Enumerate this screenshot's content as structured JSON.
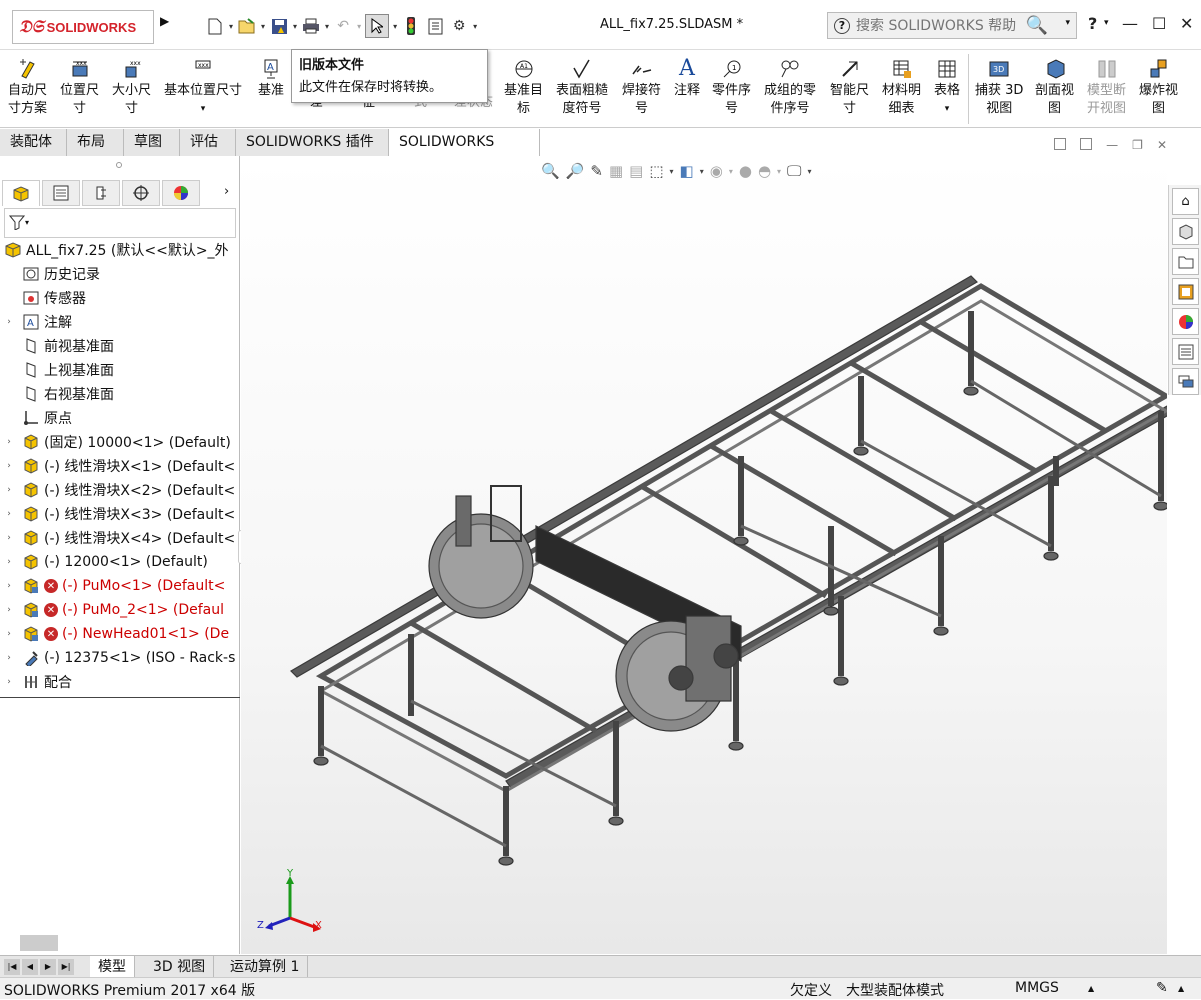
{
  "app": {
    "logo_brand": "SOLIDWORKS",
    "document_title": "ALL_fix7.25.SLDASM *"
  },
  "search": {
    "placeholder": "搜索 SOLIDWORKS 帮助"
  },
  "window_controls": {
    "help": "?",
    "minimize": "—",
    "maximize": "☐",
    "close": "✕"
  },
  "tooltip": {
    "title": "旧版本文件",
    "text": "此文件在保存时将转换。"
  },
  "ribbon": {
    "items": [
      {
        "id": "auto-dim",
        "line1": "自动尺",
        "line2": "寸方案",
        "icon": "auto-dimension-icon",
        "enabled": true
      },
      {
        "id": "loc-dim",
        "line1": "位置尺",
        "line2": "寸",
        "icon": "location-dimension-icon",
        "enabled": true
      },
      {
        "id": "size-dim",
        "line1": "大小尺",
        "line2": "寸",
        "icon": "size-dimension-icon",
        "enabled": true
      },
      {
        "id": "basic-loc-dim",
        "line1": "基本位置尺寸",
        "line2": "▾",
        "icon": "basic-location-icon",
        "enabled": true
      },
      {
        "id": "datum",
        "line1": "基准",
        "line2": "",
        "icon": "datum-icon",
        "enabled": true
      },
      {
        "id": "tolerance",
        "line1": "",
        "line2": "差",
        "icon": "",
        "enabled": true
      },
      {
        "id": "feature",
        "line1": "",
        "line2": "征",
        "icon": "",
        "enabled": true
      },
      {
        "id": "style",
        "line1": "",
        "line2": "式",
        "icon": "",
        "enabled": false
      },
      {
        "id": "tol-state",
        "line1": "公",
        "line2": "差状态",
        "icon": "",
        "enabled": false
      },
      {
        "id": "datum-target",
        "line1": "基准目",
        "line2": "标",
        "icon": "datum-target-icon",
        "enabled": true
      },
      {
        "id": "surface-finish",
        "line1": "表面粗糙",
        "line2": "度符号",
        "icon": "surface-finish-icon",
        "enabled": true
      },
      {
        "id": "weld",
        "line1": "焊接符",
        "line2": "号",
        "icon": "weld-symbol-icon",
        "enabled": true
      },
      {
        "id": "note",
        "line1": "注释",
        "line2": "",
        "icon": "note-icon",
        "enabled": true
      },
      {
        "id": "balloon",
        "line1": "零件序",
        "line2": "号",
        "icon": "balloon-icon",
        "enabled": true
      },
      {
        "id": "stacked-balloon",
        "line1": "成组的零",
        "line2": "件序号",
        "icon": "stacked-balloon-icon",
        "enabled": true
      },
      {
        "id": "smart-dim",
        "line1": "智能尺",
        "line2": "寸",
        "icon": "smart-dimension-icon",
        "enabled": true
      },
      {
        "id": "bom",
        "line1": "材料明",
        "line2": "细表",
        "icon": "bom-icon",
        "enabled": true
      },
      {
        "id": "table",
        "line1": "表格",
        "line2": "▾",
        "icon": "table-icon",
        "enabled": true
      },
      {
        "id": "capture-3d",
        "line1": "捕获 3D",
        "line2": "视图",
        "icon": "capture-3d-view-icon",
        "enabled": true
      },
      {
        "id": "section-view",
        "line1": "剖面视",
        "line2": "图",
        "icon": "section-view-icon",
        "enabled": true
      },
      {
        "id": "model-break",
        "line1": "模型断",
        "line2": "开视图",
        "icon": "model-break-icon",
        "enabled": false
      },
      {
        "id": "explode",
        "line1": "爆炸视",
        "line2": "图",
        "icon": "explode-view-icon",
        "enabled": true
      }
    ]
  },
  "command_tabs": [
    "装配体",
    "布局",
    "草图",
    "评估",
    "SOLIDWORKS 插件",
    "SOLIDWORKS MBD"
  ],
  "tree": {
    "root": "ALL_fix7.25  (默认<<默认>_外",
    "items": [
      {
        "label": "历史记录",
        "icon": "history-icon",
        "arrow": "",
        "color": "normal",
        "error": false
      },
      {
        "label": "传感器",
        "icon": "sensor-icon",
        "arrow": "",
        "color": "normal",
        "error": false
      },
      {
        "label": "注解",
        "icon": "annotation-icon",
        "arrow": "›",
        "color": "normal",
        "error": false
      },
      {
        "label": "前视基准面",
        "icon": "plane-icon",
        "arrow": "",
        "color": "normal",
        "error": false
      },
      {
        "label": "上视基准面",
        "icon": "plane-icon",
        "arrow": "",
        "color": "normal",
        "error": false
      },
      {
        "label": "右视基准面",
        "icon": "plane-icon",
        "arrow": "",
        "color": "normal",
        "error": false
      },
      {
        "label": "原点",
        "icon": "origin-icon",
        "arrow": "",
        "color": "normal",
        "error": false
      },
      {
        "label": "(固定) 10000<1> (Default)",
        "icon": "part-icon",
        "arrow": "›",
        "color": "normal",
        "error": false
      },
      {
        "label": "(-) 线性滑块X<1> (Default<",
        "icon": "part-icon",
        "arrow": "›",
        "color": "normal",
        "error": false
      },
      {
        "label": "(-) 线性滑块X<2> (Default<",
        "icon": "part-icon",
        "arrow": "›",
        "color": "normal",
        "error": false
      },
      {
        "label": "(-) 线性滑块X<3> (Default<",
        "icon": "part-icon",
        "arrow": "›",
        "color": "normal",
        "error": false
      },
      {
        "label": "(-) 线性滑块X<4> (Default<",
        "icon": "part-icon",
        "arrow": "›",
        "color": "normal",
        "error": false
      },
      {
        "label": "(-) 12000<1> (Default)",
        "icon": "part-icon",
        "arrow": "›",
        "color": "normal",
        "error": false
      },
      {
        "label": "(-) PuMo<1> (Default<",
        "icon": "assembly-icon",
        "arrow": "›",
        "color": "red",
        "error": true
      },
      {
        "label": "(-) PuMo_2<1> (Defaul",
        "icon": "assembly-icon",
        "arrow": "›",
        "color": "red",
        "error": true
      },
      {
        "label": "(-) NewHead01<1> (De",
        "icon": "assembly-icon",
        "arrow": "›",
        "color": "red",
        "error": true
      },
      {
        "label": "(-) 12375<1> (ISO - Rack-s",
        "icon": "toolbox-part-icon",
        "arrow": "›",
        "color": "normal",
        "error": false
      },
      {
        "label": "配合",
        "icon": "mates-icon",
        "arrow": "›",
        "color": "normal",
        "error": false
      }
    ]
  },
  "bottom_tabs": [
    "模型",
    "3D 视图",
    "运动算例 1"
  ],
  "status": {
    "product": "SOLIDWORKS Premium 2017 x64 版",
    "state": "欠定义",
    "mode": "大型装配体模式",
    "units": "MMGS"
  },
  "triad": {
    "x": "X",
    "y": "Y",
    "z": "Z"
  },
  "colors": {
    "accent": "#d4232b",
    "error": "#c62828",
    "tree_error_text": "#c00000"
  }
}
